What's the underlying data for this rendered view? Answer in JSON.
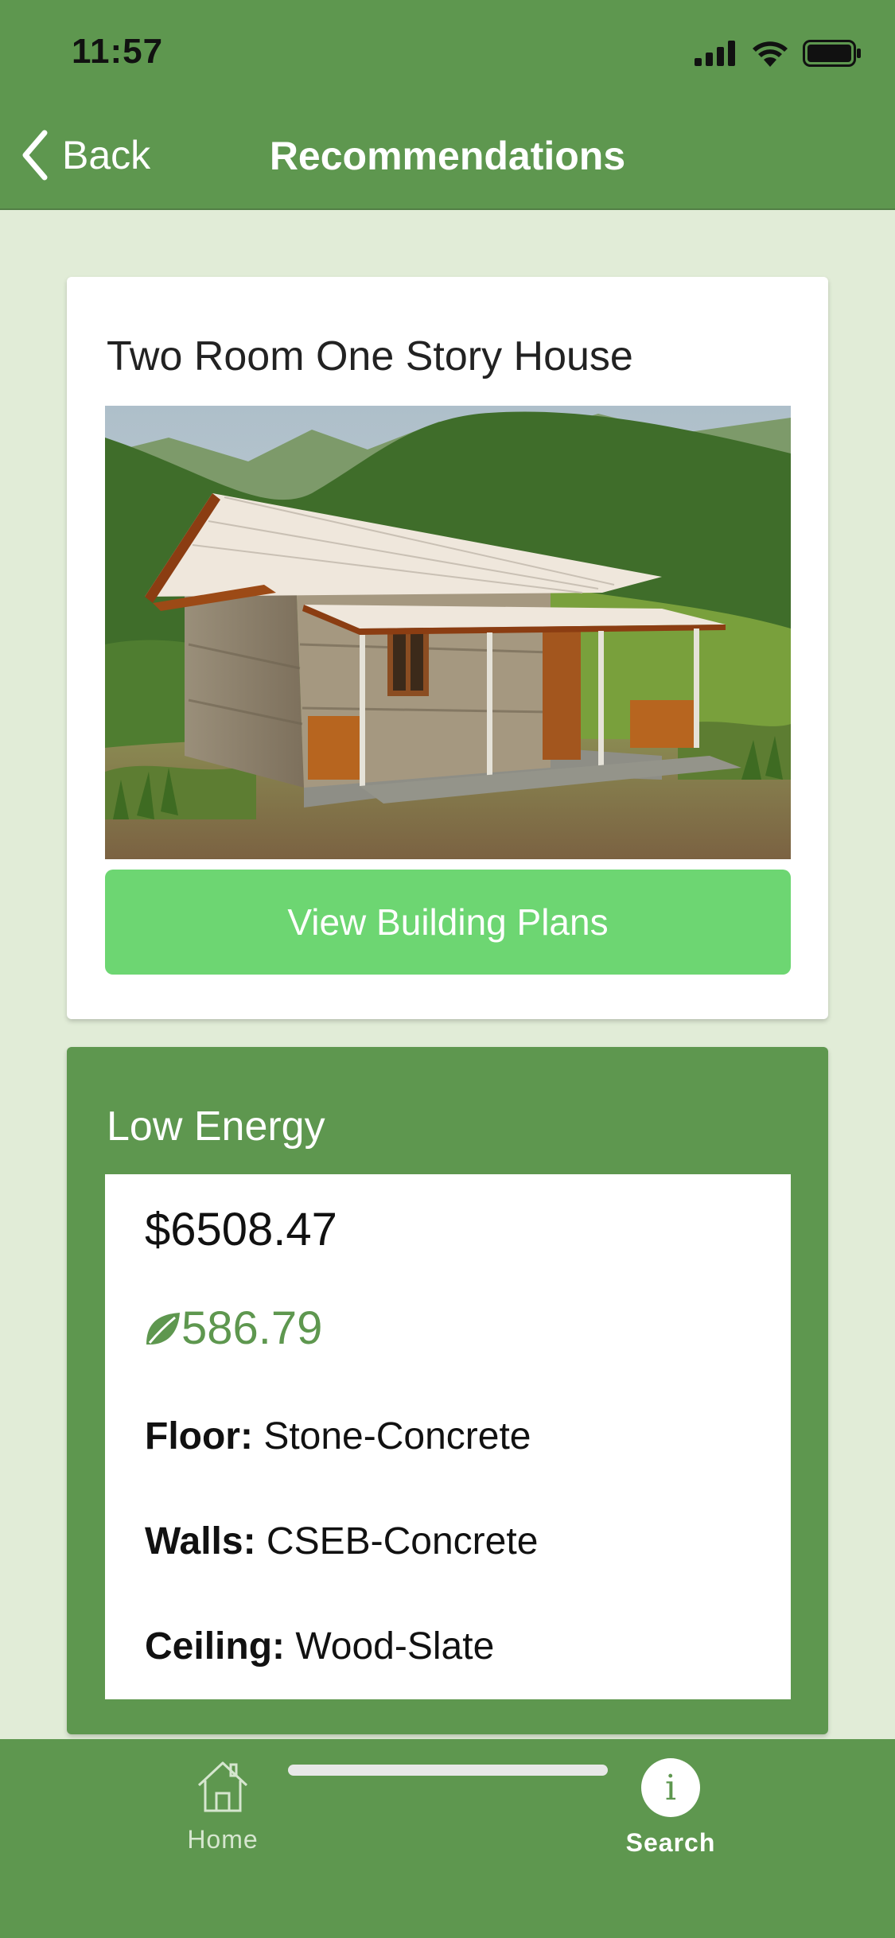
{
  "status_bar": {
    "time": "11:57"
  },
  "nav": {
    "back_label": "Back",
    "title": "Recommendations"
  },
  "house_card": {
    "title": "Two Room One Story House",
    "plans_button_label": "View Building Plans"
  },
  "energy_card": {
    "title": "Low Energy",
    "price": "$6508.47",
    "eco_value": "586.79",
    "specs": [
      {
        "label": "Floor:",
        "value": "Stone-Concrete"
      },
      {
        "label": "Walls:",
        "value": "CSEB-Concrete"
      },
      {
        "label": "Ceiling:",
        "value": "Wood-Slate"
      }
    ]
  },
  "tabbar": {
    "tabs": [
      {
        "label": "Home",
        "icon": "home-icon"
      },
      {
        "label": "Search",
        "icon": "info-icon",
        "active": true
      }
    ]
  },
  "colors": {
    "primary_green": "#5e974f",
    "button_green": "#6dd672",
    "background": "#e1ecd7"
  }
}
